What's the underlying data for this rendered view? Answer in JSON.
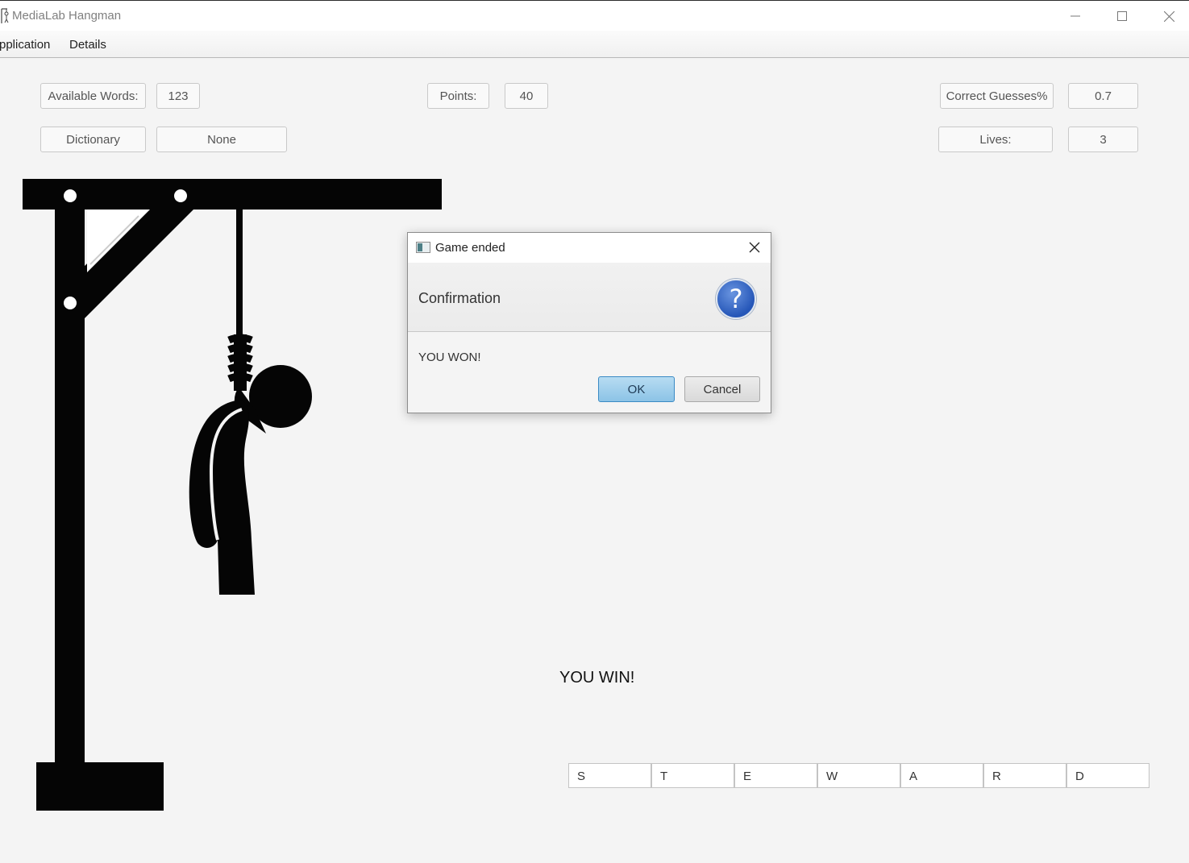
{
  "window": {
    "title": "MediaLab Hangman"
  },
  "menu": {
    "items": [
      "pplication",
      "Details"
    ]
  },
  "stats": {
    "available_words_label": "Available Words:",
    "available_words_value": "123",
    "points_label": "Points:",
    "points_value": "40",
    "correct_label": "Correct Guesses%",
    "correct_value": "0.7",
    "dictionary_label": "Dictionary",
    "dictionary_value": "None",
    "lives_label": "Lives:",
    "lives_value": "3"
  },
  "dialog": {
    "title": "Game ended",
    "header": "Confirmation",
    "icon": "question-icon",
    "content": "YOU WON!",
    "ok_label": "OK",
    "cancel_label": "Cancel"
  },
  "result_text": "YOU WIN!",
  "word_letters": [
    "S",
    "T",
    "E",
    "W",
    "A",
    "R",
    "D"
  ],
  "colors": {
    "background": "#f4f4f4",
    "ok_button": "#9fd0ee",
    "question_icon": "#2f62c4"
  }
}
